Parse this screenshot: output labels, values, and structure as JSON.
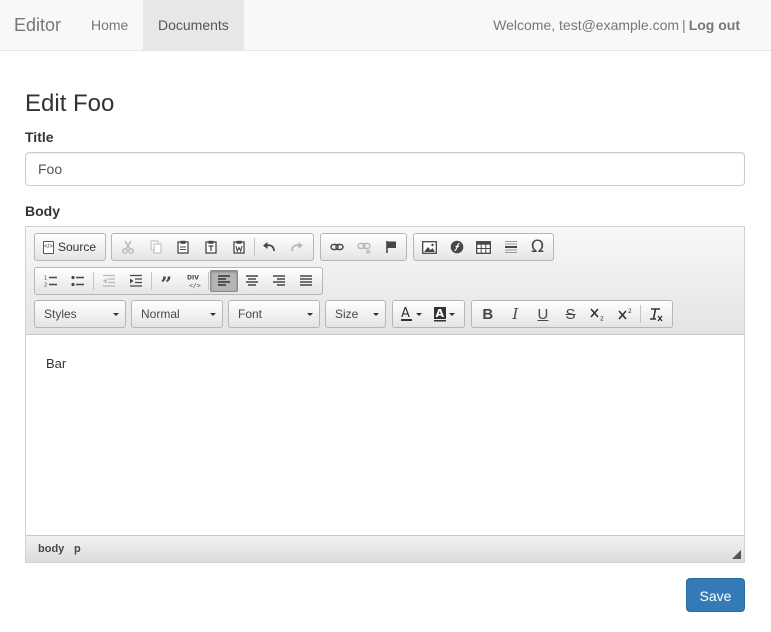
{
  "navbar": {
    "brand": "Editor",
    "items": [
      {
        "label": "Home"
      },
      {
        "label": "Documents"
      }
    ],
    "welcome": "Welcome, test@example.com",
    "separator": "|",
    "logout": "Log out"
  },
  "page": {
    "heading": "Edit Foo",
    "title_label": "Title",
    "title_value": "Foo",
    "body_label": "Body",
    "save_label": "Save"
  },
  "editor": {
    "source_label": "Source",
    "combos": {
      "styles": "Styles",
      "format": "Normal",
      "font": "Font",
      "size": "Size"
    },
    "content": "Bar",
    "path": [
      "body",
      "p"
    ],
    "icons": {
      "row1": [
        "cut-icon",
        "copy-icon",
        "paste-icon",
        "paste-text-icon",
        "paste-word-icon",
        "undo-icon",
        "redo-icon",
        "link-icon",
        "unlink-icon",
        "anchor-icon",
        "image-icon",
        "flash-icon",
        "table-icon",
        "horizontal-line-icon",
        "special-char-icon"
      ],
      "row2": [
        "numbered-list-icon",
        "bulleted-list-icon",
        "outdent-icon",
        "indent-icon",
        "blockquote-icon",
        "div-icon",
        "align-left-icon",
        "align-center-icon",
        "align-right-icon",
        "justify-icon"
      ],
      "row3": [
        "text-color-icon",
        "background-color-icon",
        "bold-icon",
        "italic-icon",
        "underline-icon",
        "strikethrough-icon",
        "subscript-icon",
        "superscript-icon",
        "remove-format-icon"
      ]
    }
  }
}
